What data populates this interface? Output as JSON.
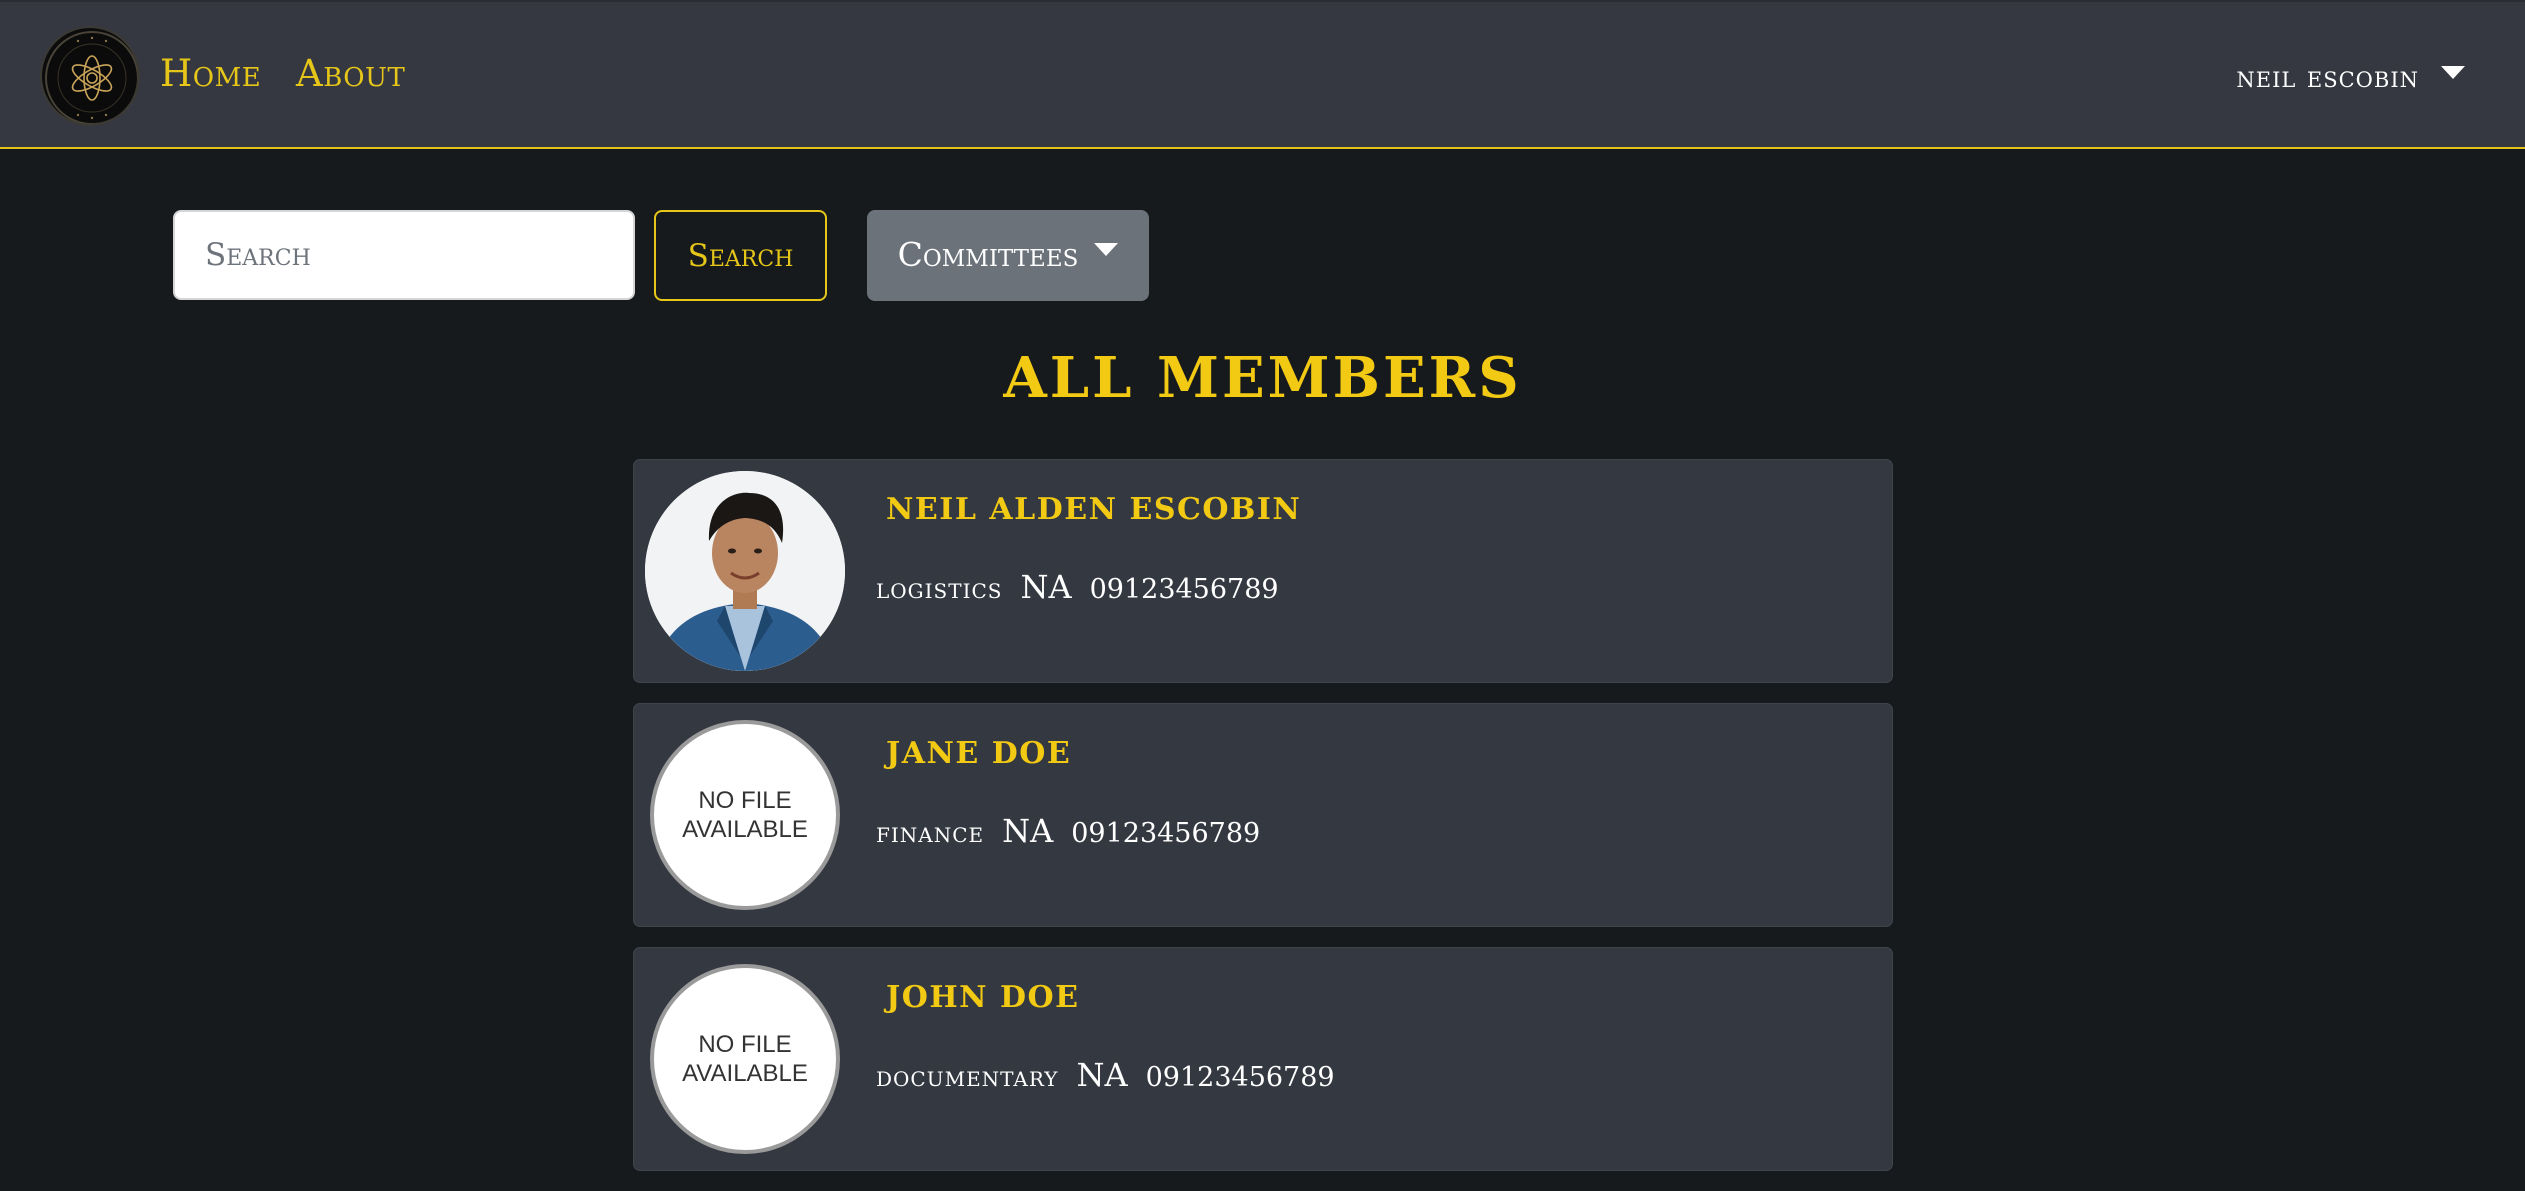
{
  "nav": {
    "home": "Home",
    "about": "About",
    "user": "NEIL ESCOBIN"
  },
  "search": {
    "placeholder": "Search",
    "button": "Search"
  },
  "filter": {
    "committees": "Committees"
  },
  "page_title": "ALL MEMBERS",
  "members": [
    {
      "name": "NEIL ALDEN ESCOBIN",
      "committee": "logistics",
      "status": "NA",
      "phone": "09123456789",
      "avatar": "photo"
    },
    {
      "name": "JANE DOE",
      "committee": "finance",
      "status": "NA",
      "phone": "09123456789",
      "avatar_text": "NO FILE\nAVAILABLE"
    },
    {
      "name": "JOHN DOE",
      "committee": "documentary",
      "status": "NA",
      "phone": "09123456789",
      "avatar_text": "NO FILE\nAVAILABLE"
    }
  ],
  "colors": {
    "accent": "#e5c619",
    "navbar": "#353840",
    "background": "#171a1d",
    "card": "#343841",
    "secondary_button": "#6b727a"
  },
  "icons": {
    "logo": "org-logo-icon",
    "dropdown": "caret-down-icon"
  }
}
